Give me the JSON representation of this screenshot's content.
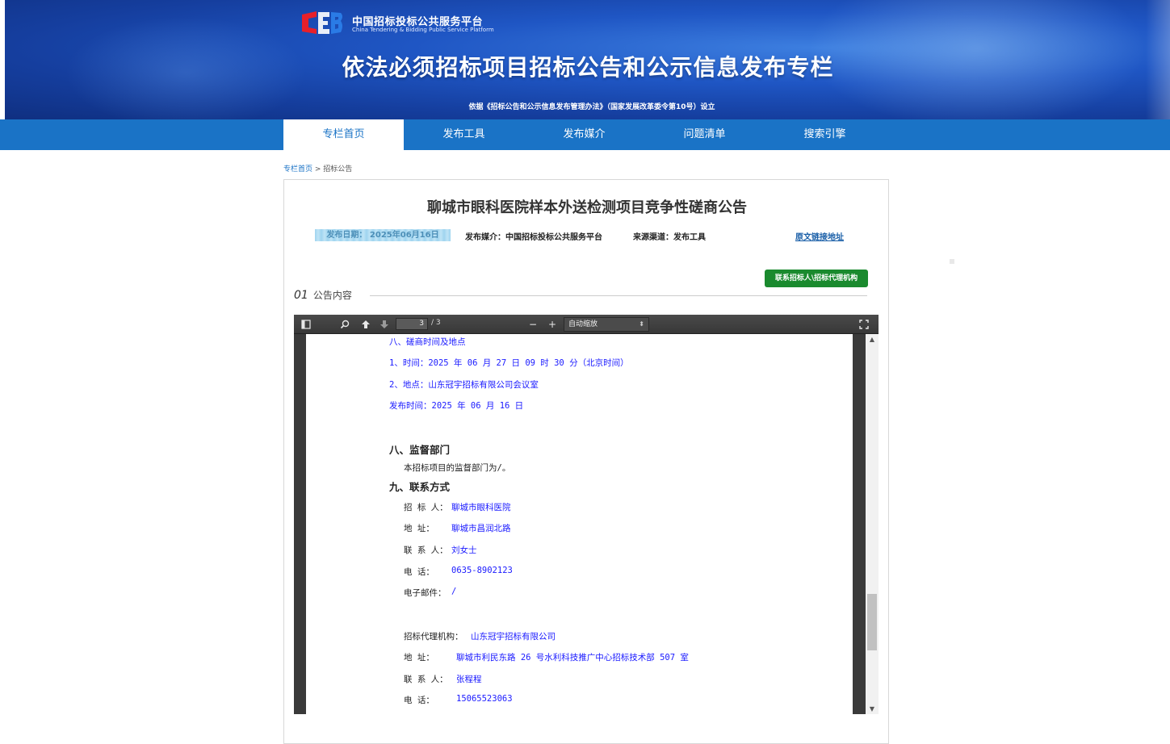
{
  "header": {
    "logo_cn": "中国招标投标公共服务平台",
    "logo_en": "China Tendering & Bidding Public Service Platform",
    "title": "依法必须招标项目招标公告和公示信息发布专栏",
    "subtitle": "依据《招标公告和公示信息发布管理办法》（国家发展改革委令第10号）设立"
  },
  "nav": {
    "items": [
      {
        "label": "专栏首页",
        "active": true
      },
      {
        "label": "发布工具",
        "active": false
      },
      {
        "label": "发布媒介",
        "active": false
      },
      {
        "label": "问题清单",
        "active": false
      },
      {
        "label": "搜索引擎",
        "active": false
      }
    ]
  },
  "breadcrumb": {
    "home": "专栏首页",
    "sep": " > ",
    "current": "招标公告"
  },
  "notice": {
    "title": "聊城市眼科医院样本外送检测项目竞争性磋商公告",
    "publish_date": "发布日期： 2025年06月16日",
    "media": "发布媒介：中国招标投标公共服务平台",
    "channel": "来源渠道：发布工具",
    "orig_link": "原文链接地址",
    "contact_button": "联系招标人\\招标代理机构",
    "section_num": "01",
    "section_title": "公告内容"
  },
  "pdf": {
    "current_page": "3",
    "total_pages": "/ 3",
    "zoom": "自动缩放",
    "lines": {
      "l1": "八、磋商时间及地点",
      "l2": "1、时间：2025 年 06 月 27 日 09 时 30 分（北京时间）",
      "l3": "2、地点：山东冠宇招标有限公司会议室",
      "l4": "发布时间：2025 年 06 月 16 日",
      "h1": "八、监督部门",
      "l5": "本招标项目的监督部门为/。",
      "h2": "九、联系方式",
      "c1_label": "招 标 人：",
      "c1_value": "聊城市眼科医院",
      "c2_label": "地     址：",
      "c2_value": "聊城市昌润北路",
      "c3_label": "联 系 人：",
      "c3_value": "刘女士",
      "c4_label": "电     话：",
      "c4_value": "0635-8902123",
      "c5_label": "电子邮件：",
      "c5_value": "/",
      "a1_label": "招标代理机构：",
      "a1_value": "山东冠宇招标有限公司",
      "a2_label": "地     址：",
      "a2_value": "聊城市利民东路 26 号水利科技推广中心招标技术部 507 室",
      "a3_label": "联 系 人：",
      "a3_value": "张程程",
      "a4_label": "电     话：",
      "a4_value": "15065523063"
    }
  }
}
